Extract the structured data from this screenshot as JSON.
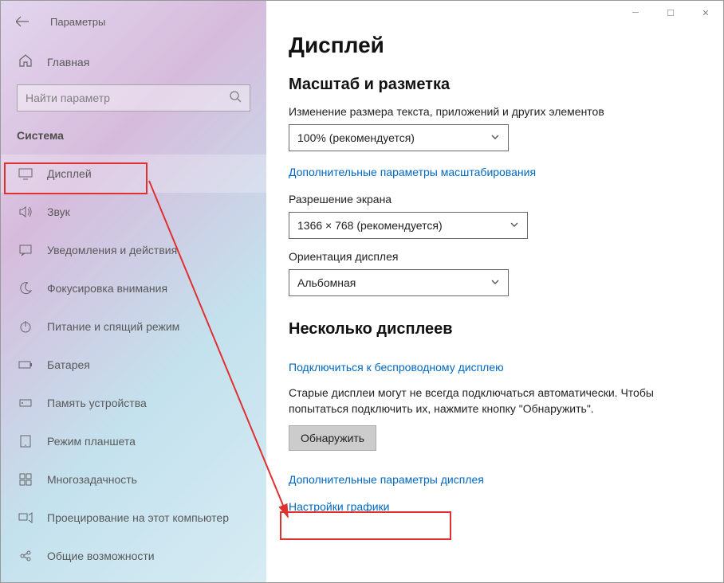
{
  "window": {
    "title": "Параметры"
  },
  "sidebar": {
    "home": "Главная",
    "search_placeholder": "Найти параметр",
    "section": "Система",
    "items": [
      {
        "label": "Дисплей"
      },
      {
        "label": "Звук"
      },
      {
        "label": "Уведомления и действия"
      },
      {
        "label": "Фокусировка внимания"
      },
      {
        "label": "Питание и спящий режим"
      },
      {
        "label": "Батарея"
      },
      {
        "label": "Память устройства"
      },
      {
        "label": "Режим планшета"
      },
      {
        "label": "Многозадачность"
      },
      {
        "label": "Проецирование на этот компьютер"
      },
      {
        "label": "Общие возможности"
      }
    ]
  },
  "content": {
    "title": "Дисплей",
    "scale_section": "Масштаб и разметка",
    "scale_label": "Изменение размера текста, приложений и других элементов",
    "scale_value": "100% (рекомендуется)",
    "scale_link": "Дополнительные параметры масштабирования",
    "res_label": "Разрешение экрана",
    "res_value": "1366 × 768 (рекомендуется)",
    "orient_label": "Ориентация дисплея",
    "orient_value": "Альбомная",
    "multi_section": "Несколько дисплеев",
    "wireless_link": "Подключиться к беспроводному дисплею",
    "old_displays_text": "Старые дисплеи могут не всегда подключаться автоматически. Чтобы попытаться подключить их, нажмите кнопку \"Обнаружить\".",
    "detect_btn": "Обнаружить",
    "adv_display_link": "Дополнительные параметры дисплея",
    "graphics_link": "Настройки графики"
  }
}
